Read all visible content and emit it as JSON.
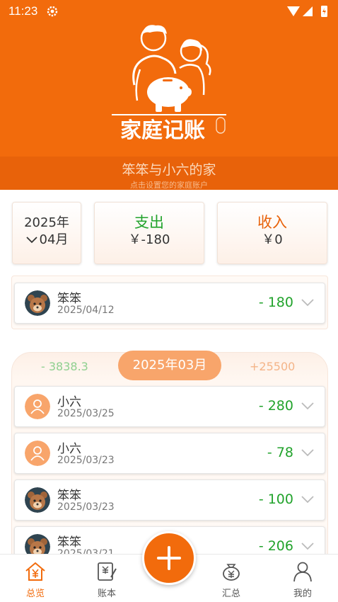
{
  "status_bar": {
    "time": "11:23"
  },
  "header": {
    "logo_text": "家庭记账",
    "family_name": "笨笨与小六的家",
    "family_hint": "点击设置您的家庭账户"
  },
  "summary": {
    "year": "2025年",
    "month": "04月",
    "expense_label": "支出",
    "expense_value": "￥-180",
    "income_label": "收入",
    "income_value": "￥0"
  },
  "current_entries": [
    {
      "name": "笨笨",
      "date": "2025/04/12",
      "amount": "- 180",
      "avatar": "bear-avatar"
    }
  ],
  "march_group": {
    "expense_total": "- 3838.3",
    "month_label": "2025年03月",
    "income_total": "+25500",
    "entries": [
      {
        "name": "小六",
        "date": "2025/03/25",
        "amount": "- 280",
        "avatar": "user-avatar"
      },
      {
        "name": "小六",
        "date": "2025/03/23",
        "amount": "- 78",
        "avatar": "user-avatar"
      },
      {
        "name": "笨笨",
        "date": "2025/03/23",
        "amount": "- 100",
        "avatar": "bear-avatar"
      },
      {
        "name": "笨笨",
        "date": "2025/03/21",
        "amount": "- 206",
        "avatar": "bear-avatar"
      }
    ]
  },
  "bottom_nav": {
    "items": [
      {
        "label": "总览",
        "icon": "house-yuan-icon",
        "active": true
      },
      {
        "label": "账本",
        "icon": "ledger-icon",
        "active": false
      },
      {
        "label": "汇总",
        "icon": "money-bag-icon",
        "active": false
      },
      {
        "label": "我的",
        "icon": "person-icon",
        "active": false
      }
    ]
  },
  "colors": {
    "primary": "#f26b0c",
    "expense_green": "#22a32c",
    "pill": "#f8a56b"
  }
}
